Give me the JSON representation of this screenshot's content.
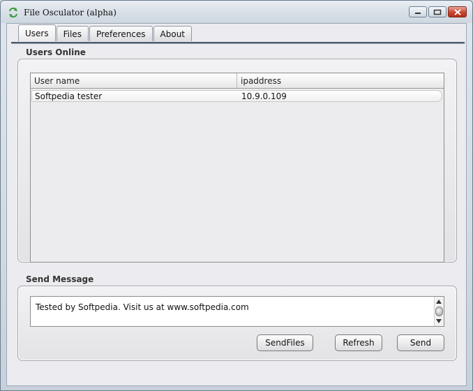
{
  "window": {
    "title": "File Osculator (alpha)",
    "icon": "refresh-arrows-icon"
  },
  "tabs": [
    {
      "label": "Users",
      "active": true
    },
    {
      "label": "Files",
      "active": false
    },
    {
      "label": "Preferences",
      "active": false
    },
    {
      "label": "About",
      "active": false
    }
  ],
  "users_online": {
    "section_label": "Users Online",
    "columns": [
      "User name",
      "ipaddress"
    ],
    "rows": [
      {
        "user_name": "Softpedia tester",
        "ipaddress": "10.9.0.109"
      }
    ]
  },
  "send_message": {
    "section_label": "Send Message",
    "message_text": "Tested by Softpedia. Visit us at www.softpedia.com"
  },
  "buttons": {
    "send_files": "SendFiles",
    "refresh": "Refresh",
    "send": "Send"
  },
  "colors": {
    "tab_separator": "#4d5870",
    "close_button": "#c9442e"
  }
}
